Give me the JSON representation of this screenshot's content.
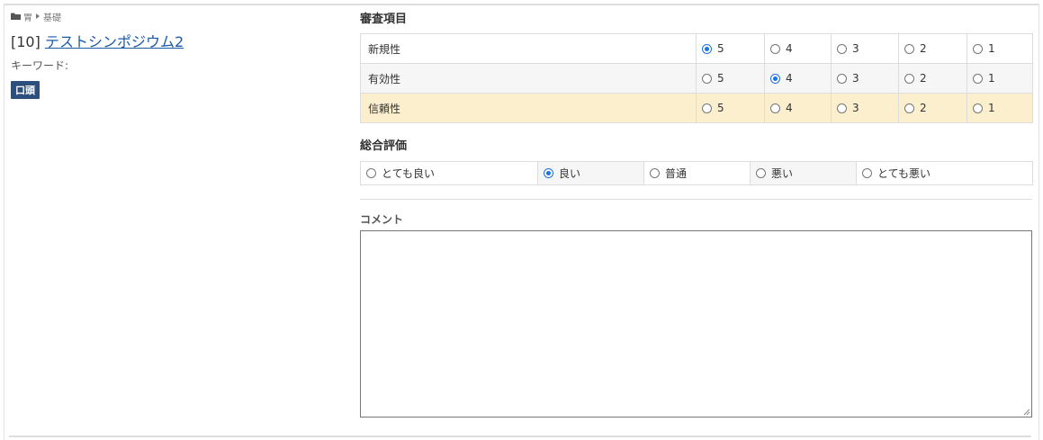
{
  "breadcrumb": {
    "items": [
      "胃",
      "基礎"
    ]
  },
  "paper": {
    "number": "[10]",
    "title": "テストシンポジウム2",
    "keyword_label": "キーワード:",
    "badge": "口頭"
  },
  "criteria": {
    "title": "審査項目",
    "rows": [
      {
        "label": "新規性",
        "options": [
          "5",
          "4",
          "3",
          "2",
          "1"
        ],
        "selected": "5"
      },
      {
        "label": "有効性",
        "options": [
          "5",
          "4",
          "3",
          "2",
          "1"
        ],
        "selected": "4"
      },
      {
        "label": "信頼性",
        "options": [
          "5",
          "4",
          "3",
          "2",
          "1"
        ],
        "selected": null
      }
    ]
  },
  "overall": {
    "title": "総合評価",
    "options": [
      "とても良い",
      "良い",
      "普通",
      "悪い",
      "とても悪い"
    ],
    "selected": "良い"
  },
  "comment": {
    "label": "コメント",
    "value": ""
  },
  "colors": {
    "link": "#1a5aa8",
    "badge_bg": "#2c4f7c",
    "highlight_row": "#fcefce",
    "radio_checked": "#1a73e8"
  }
}
